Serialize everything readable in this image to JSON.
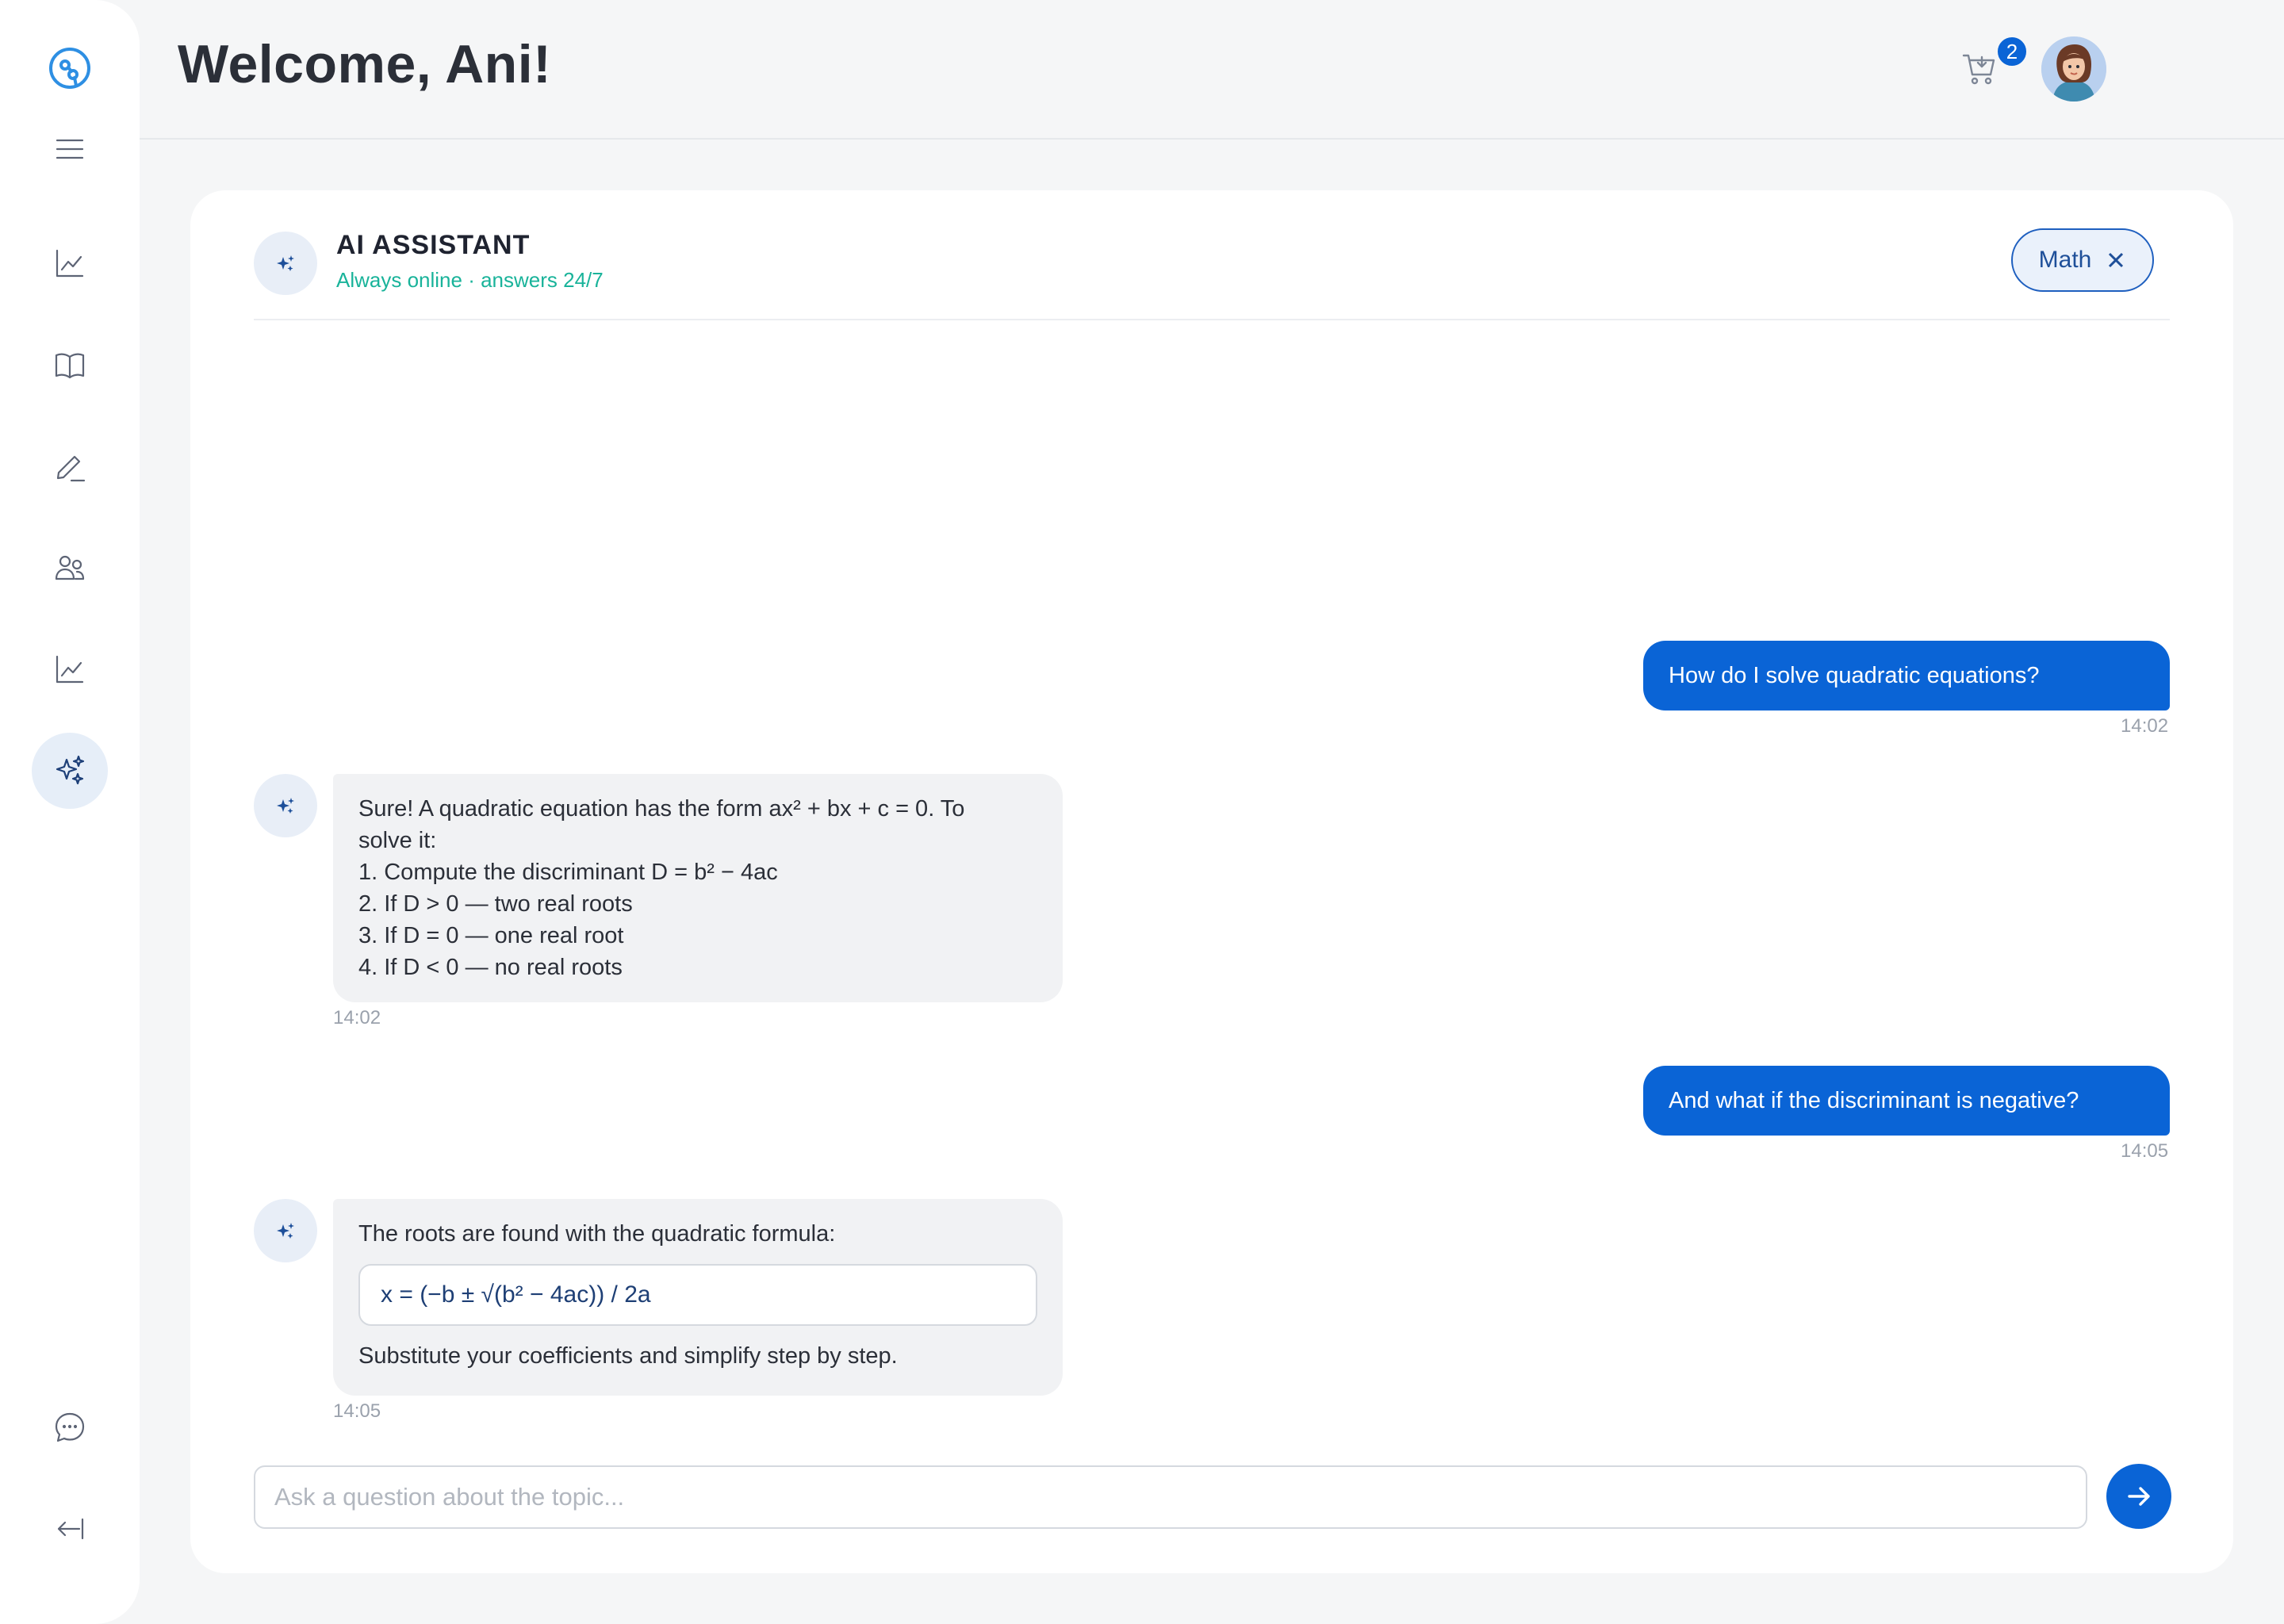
{
  "header": {
    "welcome": "Welcome, Ani!",
    "cart_count": "2"
  },
  "sidebar": {
    "items": [
      {
        "icon": "menu-icon"
      },
      {
        "icon": "chart-icon"
      },
      {
        "icon": "book-icon"
      },
      {
        "icon": "pencil-icon"
      },
      {
        "icon": "users-icon"
      },
      {
        "icon": "analytics-icon"
      },
      {
        "icon": "sparkles-icon",
        "active": true
      },
      {
        "icon": "chat-icon"
      },
      {
        "icon": "collapse-icon"
      }
    ]
  },
  "chat": {
    "title": "AI ASSISTANT",
    "status": "Always online · answers 24/7",
    "topic": "Math",
    "messages": [
      {
        "role": "user",
        "text": "How do I solve quadratic equations?",
        "time": "14:02"
      },
      {
        "role": "bot",
        "lines": [
          "Sure! A quadratic equation has the form ax² + bx + c = 0. To",
          "solve it:",
          "1. Compute the discriminant D = b² − 4ac",
          "2. If D > 0 — two real roots",
          "3. If D = 0 — one real root",
          "4. If D < 0 — no real roots"
        ],
        "time": "14:02"
      },
      {
        "role": "user",
        "text": "And what if the discriminant is negative?",
        "time": "14:05"
      },
      {
        "role": "bot",
        "intro": "The roots are found with the quadratic formula:",
        "formula": "x = (−b ± √(b² − 4ac)) / 2a",
        "outro": "Substitute your coefficients and simplify step by step.",
        "time": "14:05"
      }
    ],
    "input_placeholder": "Ask a question about the topic..."
  },
  "colors": {
    "accent": "#0a64d6",
    "status_green": "#19b39a",
    "bubble_bot": "#f1f2f4"
  }
}
